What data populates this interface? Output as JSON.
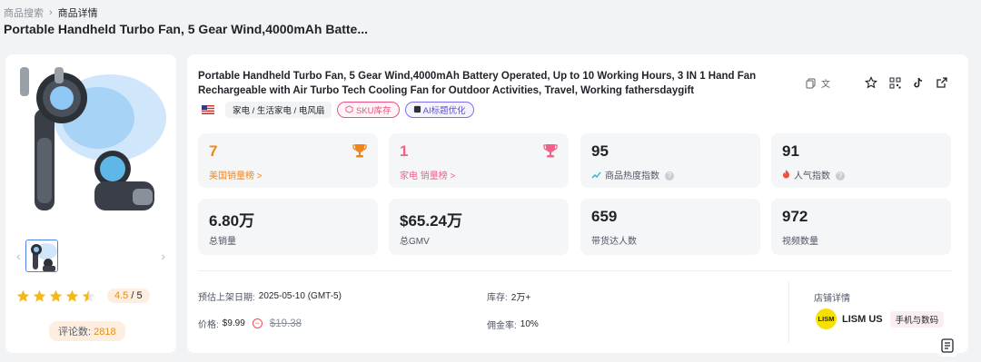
{
  "breadcrumb": {
    "parent": "商品搜索",
    "current": "商品详情"
  },
  "page_title": "Portable Handheld Turbo Fan, 5 Gear Wind,4000mAh Batte...",
  "product": {
    "title": "Portable Handheld Turbo Fan, 5 Gear Wind,4000mAh Battery Operated, Up to 10 Working Hours, 3 IN 1 Hand Fan Rechargeable with Air Turbo Tech Cooling Fan for Outdoor Activities, Travel, Working fathersdaygift",
    "translate_label": "文",
    "category": "家电 / 生活家电 / 电风扇",
    "sku_tag": "SKU库存",
    "ai_tag": "AI标题优化"
  },
  "gallery": {
    "prev": "‹",
    "next": "›"
  },
  "rating": {
    "stars": 4.5,
    "score": "4.5",
    "denominator": "/ 5",
    "reviews_label": "评论数:",
    "reviews_count": "2818"
  },
  "stats": {
    "us_rank": {
      "value": "7",
      "label": "美国销量榜 >"
    },
    "cat_rank": {
      "value": "1",
      "label": "家电 销量榜 >"
    },
    "heat": {
      "value": "95",
      "label": "商品热度指数"
    },
    "popularity": {
      "value": "91",
      "label": "人气指数"
    },
    "sales": {
      "value": "6.80万",
      "label": "总销量"
    },
    "gmv": {
      "value": "$65.24万",
      "label": "总GMV"
    },
    "creators": {
      "value": "659",
      "label": "带货达人数"
    },
    "videos": {
      "value": "972",
      "label": "视频数量"
    }
  },
  "info": {
    "listing_date_label": "预估上架日期:",
    "listing_date": "2025-05-10 (GMT-5)",
    "stock_label": "库存:",
    "stock": "2万+",
    "price_label": "价格:",
    "price": "$9.99",
    "old_price": "$19.38",
    "commission_label": "佣金率:",
    "commission": "10%"
  },
  "store": {
    "title": "店铺详情",
    "logo": "LISM",
    "name": "LISM US",
    "category": "手机与数码"
  },
  "colors": {
    "orange": "#f0861a",
    "pink": "#f0628a",
    "accent_blue": "#4d7ff2",
    "store_yellow": "#f5e000"
  },
  "icons": [
    "copy-icon",
    "translate-icon",
    "favorite-star-icon",
    "qr-code-icon",
    "tiktok-icon",
    "external-link-icon",
    "trophy-icon",
    "trend-icon",
    "flame-icon",
    "document-icon"
  ]
}
